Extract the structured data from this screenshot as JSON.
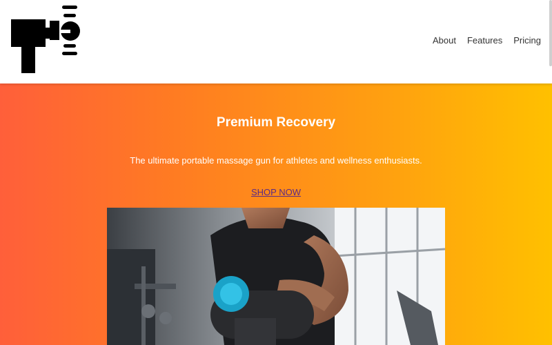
{
  "brand": {
    "logo_icon": "massage-gun-logo-icon"
  },
  "nav": {
    "items": [
      "About",
      "Features",
      "Pricing"
    ]
  },
  "hero": {
    "title": "Premium Recovery",
    "subtitle": "The ultimate portable massage gun for athletes and wellness enthusiasts.",
    "cta_label": "SHOP NOW",
    "gradient": [
      "#ff5f3a",
      "#ffc000"
    ]
  },
  "colors": {
    "cta": "#5a2a86",
    "nav_text": "#333333"
  }
}
